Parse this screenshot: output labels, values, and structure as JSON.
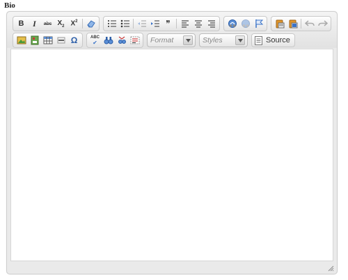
{
  "form": {
    "field_label": "Bio",
    "help_text": ""
  },
  "toolbar": {
    "row1_groups": [
      [
        "bold-icon",
        "italic-icon",
        "strikethrough-icon",
        "subscript-icon",
        "superscript-icon",
        "|",
        "remove-format-icon"
      ],
      [
        "numbered-list-icon",
        "bulleted-list-icon",
        "|",
        "outdent-icon",
        "indent-icon",
        "blockquote-icon",
        "|",
        "align-left-icon",
        "align-center-icon",
        "align-right-icon"
      ],
      [
        "link-icon",
        "unlink-icon",
        "anchor-icon"
      ],
      [
        "paste-text-icon",
        "paste-word-icon",
        "|",
        "undo-icon",
        "redo-icon"
      ]
    ],
    "row2_groups": [
      [
        "image-icon",
        "flash-icon",
        "table-icon",
        "horizontal-rule-icon",
        "special-char-icon"
      ],
      [
        "spellcheck-icon",
        "find-icon",
        "replace-icon",
        "select-all-icon"
      ]
    ],
    "format_combo": {
      "value": "Format"
    },
    "styles_combo": {
      "value": "Styles"
    },
    "source_button": {
      "label": "Source"
    },
    "labels": {
      "bold": "B",
      "italic": "I",
      "strike": "abc",
      "sub": "X",
      "sub_small": "2",
      "sup": "X",
      "sup_small": "2",
      "quote": "❞",
      "omega": "Ω",
      "spell": "ABC"
    }
  },
  "colors": {
    "toolbar_bg": "#e8e8e8",
    "accent_blue": "#3a73c8",
    "accent_green": "#4a9a3a",
    "accent_red": "#c83a3a",
    "accent_orange": "#e0952a"
  },
  "editor": {
    "content_value": ""
  }
}
